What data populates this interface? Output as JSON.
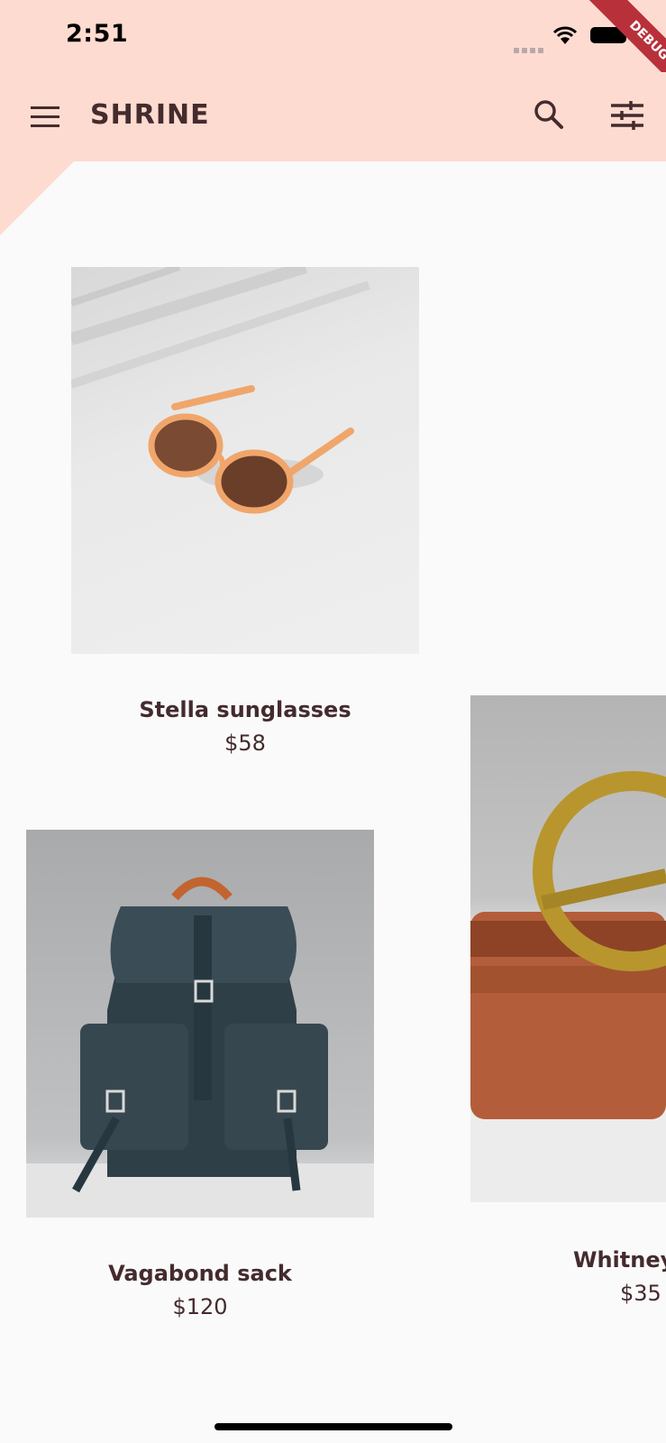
{
  "status": {
    "time": "2:51",
    "debug": "DEBUG"
  },
  "appbar": {
    "title": "SHRINE",
    "menu_icon": "menu-icon",
    "search_icon": "search-icon",
    "filter_icon": "tune-icon"
  },
  "colors": {
    "pink": "#fedbd0",
    "brown": "#442b2d",
    "background": "#fafafa"
  },
  "products": [
    {
      "name": "Stella sunglasses",
      "price": "$58",
      "image": "sunglasses"
    },
    {
      "name": "Vagabond sack",
      "price": "$120",
      "image": "backpack"
    },
    {
      "name": "Whitney",
      "price": "$35",
      "image": "belt"
    }
  ]
}
